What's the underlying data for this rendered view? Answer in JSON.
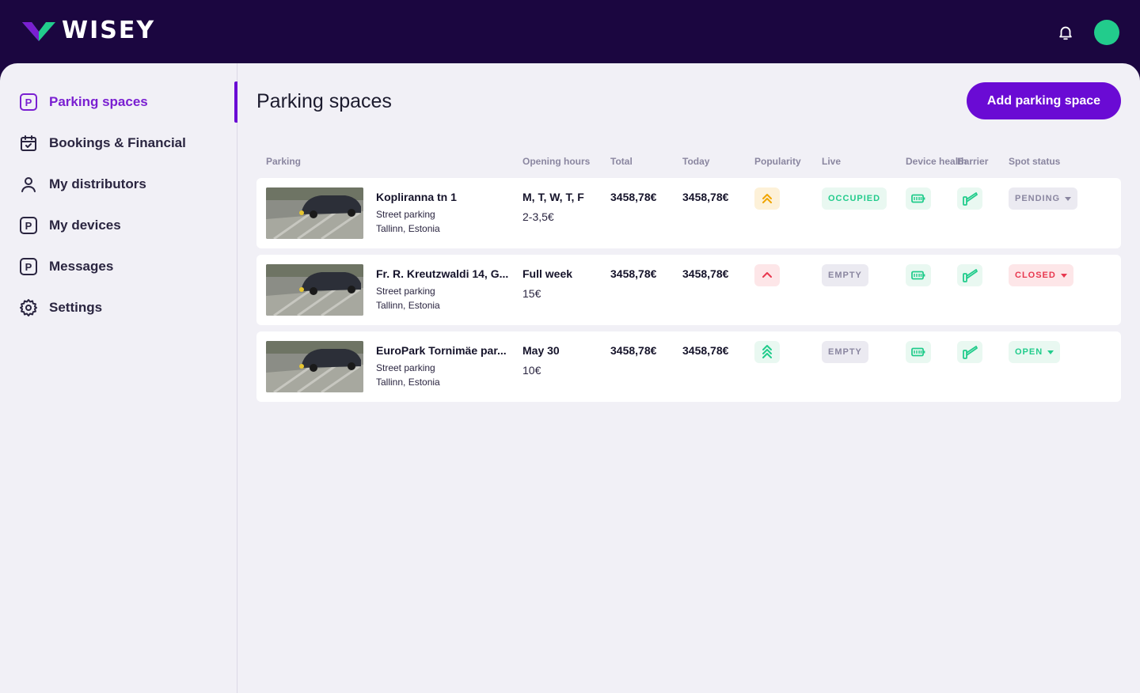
{
  "brand": {
    "name": "WISEY"
  },
  "colors": {
    "accent": "#6a0bd4",
    "topbar": "#1b0640",
    "green": "#22cc8c",
    "red": "#e8384f",
    "amber": "#f0a500"
  },
  "header": {
    "notification_icon": "bell-icon",
    "avatar_icon": "user-avatar"
  },
  "sidebar": {
    "items": [
      {
        "label": "Parking spaces",
        "icon": "parking-icon",
        "active": true
      },
      {
        "label": "Bookings & Financial",
        "icon": "calendar-check-icon"
      },
      {
        "label": "My distributors",
        "icon": "user-icon"
      },
      {
        "label": "My devices",
        "icon": "parking-icon"
      },
      {
        "label": "Messages",
        "icon": "parking-icon"
      },
      {
        "label": "Settings",
        "icon": "gear-icon"
      }
    ]
  },
  "main": {
    "title": "Parking spaces",
    "add_button": "Add parking space",
    "columns": [
      "Parking",
      "Opening hours",
      "Total",
      "Today",
      "Popularity",
      "Live",
      "Device health",
      "Barrier",
      "Spot status"
    ],
    "rows": [
      {
        "name": "Kopliranna tn 1",
        "type": "Street parking",
        "location": "Tallinn, Estonia",
        "hours": "M, T, W, T, F",
        "price": "2-3,5€",
        "total": "3458,78€",
        "today": "3458,78€",
        "popularity": "double-chevron-up-icon",
        "live": "OCCUPIED",
        "spot_status": "PENDING"
      },
      {
        "name": "Fr. R. Kreutzwaldi 14, G...",
        "type": "Street parking",
        "location": "Tallinn, Estonia",
        "hours": "Full week",
        "price": "15€",
        "total": "3458,78€",
        "today": "3458,78€",
        "popularity": "chevron-up-icon",
        "live": "EMPTY",
        "spot_status": "CLOSED"
      },
      {
        "name": "EuroPark Tornimäe par...",
        "type": "Street parking",
        "location": "Tallinn, Estonia",
        "hours": "May 30",
        "price": "10€",
        "total": "3458,78€",
        "today": "3458,78€",
        "popularity": "triple-chevron-up-icon",
        "live": "EMPTY",
        "spot_status": "OPEN"
      }
    ]
  }
}
